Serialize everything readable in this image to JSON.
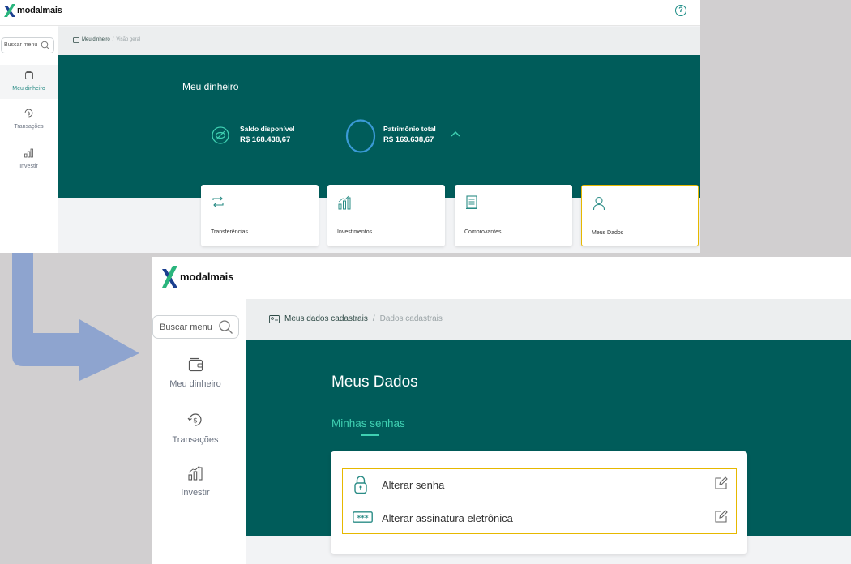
{
  "brand": "modalmais",
  "colors": {
    "teal": "#005c5a",
    "accent": "#3fd0b2",
    "highlight": "#e6b800",
    "icon": "#2a8c86"
  },
  "screen1": {
    "search_placeholder": "Buscar menu",
    "nav": [
      {
        "label": "Meu dinheiro",
        "icon": "wallet-icon"
      },
      {
        "label": "Transações",
        "icon": "transactions-icon"
      },
      {
        "label": "Investir",
        "icon": "chart-icon"
      }
    ],
    "breadcrumb": {
      "section": "Meu dinheiro",
      "separator": "/",
      "current": "Visão geral"
    },
    "help_icon": "?",
    "title": "Meu dinheiro",
    "balances": {
      "available_label": "Saldo disponível",
      "available_value": "R$ 168.438,67",
      "total_label": "Patrimônio total",
      "total_value": "R$ 169.638,67"
    },
    "cards": [
      {
        "label": "Transferências",
        "icon": "transfer-icon"
      },
      {
        "label": "Investimentos",
        "icon": "investments-icon"
      },
      {
        "label": "Comprovantes",
        "icon": "receipt-icon"
      },
      {
        "label": "Meus Dados",
        "icon": "user-icon"
      }
    ]
  },
  "screen2": {
    "search_placeholder": "Buscar menu",
    "nav": [
      {
        "label": "Meu dinheiro",
        "icon": "wallet-icon"
      },
      {
        "label": "Transações",
        "icon": "transactions-icon"
      },
      {
        "label": "Investir",
        "icon": "chart-icon"
      }
    ],
    "breadcrumb": {
      "section": "Meus dados cadastrais",
      "separator": "/",
      "current": "Dados cadastrais"
    },
    "title": "Meus Dados",
    "tab": "Minhas senhas",
    "options": [
      {
        "label": "Alterar senha",
        "icon": "lock-icon"
      },
      {
        "label": "Alterar assinatura eletrônica",
        "icon": "password-dots-icon"
      }
    ]
  }
}
